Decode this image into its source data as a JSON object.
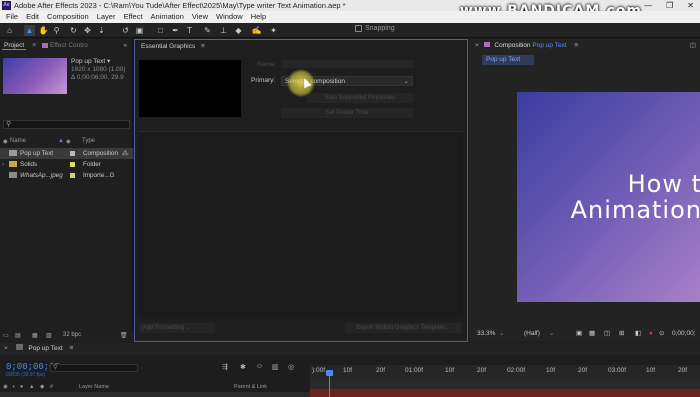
{
  "window": {
    "title": "Adobe After Effects 2023 - C:\\Ram\\You Tude\\After Effect\\2025\\May\\Type writer Text Animation.aep *",
    "logo": "Ae",
    "controls": [
      "—",
      "❐",
      "✕"
    ]
  },
  "watermark": "www.BANDICAM.com",
  "menu": [
    "File",
    "Edit",
    "Composition",
    "Layer",
    "Effect",
    "Animation",
    "View",
    "Window",
    "Help"
  ],
  "toolbar": {
    "tools": [
      "home-icon",
      "selection-tool-icon",
      "hand-tool-icon",
      "zoom-tool-icon",
      "orbit-tool-icon",
      "pan-tool-icon",
      "dolly-tool-icon",
      "rotate-tool-icon",
      "camera-tool-icon",
      "rectangle-tool-icon",
      "pen-tool-icon",
      "type-tool-icon",
      "brush-tool-icon",
      "clone-stamp-icon",
      "eraser-icon",
      "roto-brush-icon",
      "puppet-pin-icon"
    ],
    "snapping_label": "Snapping"
  },
  "project": {
    "tab_label": "Project",
    "effect_tab_label": "Effect Contro",
    "selected_name": "Pop up Text",
    "selected_info_line1": "1920 x 1080 (1.00)",
    "selected_info_line2": "Δ 0;00;06;00, 29.9",
    "search_placeholder": "⚲",
    "col_name": "Name",
    "col_type": "Type",
    "items": [
      {
        "name": "Pop up Text",
        "type": "Composition",
        "color": "#b9b9b9",
        "icon": "composition-icon"
      },
      {
        "name": "Solids",
        "type": "Folder",
        "color": "#e0d86a",
        "icon": "folder-icon"
      },
      {
        "name": "WhatsAp...jpeg",
        "type": "Importe...G",
        "color": "#d9cf78",
        "icon": "image-icon"
      }
    ],
    "bpc": "32 bpc"
  },
  "essential_graphics": {
    "tab_label": "Essential Graphics",
    "name_label": "Name:",
    "primary_label": "Primary:",
    "primary_value": "Select a composition",
    "solo_button": "Solo Supported Properties",
    "poster_button": "Set Poster Time",
    "add_formatting": "Add Formatting",
    "export_button": "Export Motion Graphics Template..."
  },
  "composition": {
    "tab_label": "Composition",
    "tab_name": "Pop up Text",
    "sub_tab": "Pop up Text",
    "viewer_line1": "How t",
    "viewer_line2": "Animation",
    "zoom": "33.3%",
    "resolution": "(Half)",
    "timecode": "0;00;00;"
  },
  "timeline": {
    "tab_label": "Pop up Text",
    "timecode": "0;00;00;05",
    "frames": "00005 (29.97 fps)",
    "search_placeholder": "⚲",
    "layer_name_col": "Layer Name",
    "parent_col": "Parent & Link",
    "ruler_ticks": [
      "):00f",
      "10f",
      "20f",
      "01:00f",
      "10f",
      "20f",
      "02:00f",
      "10f",
      "20f",
      "03:00f",
      "10f",
      "20f"
    ]
  }
}
